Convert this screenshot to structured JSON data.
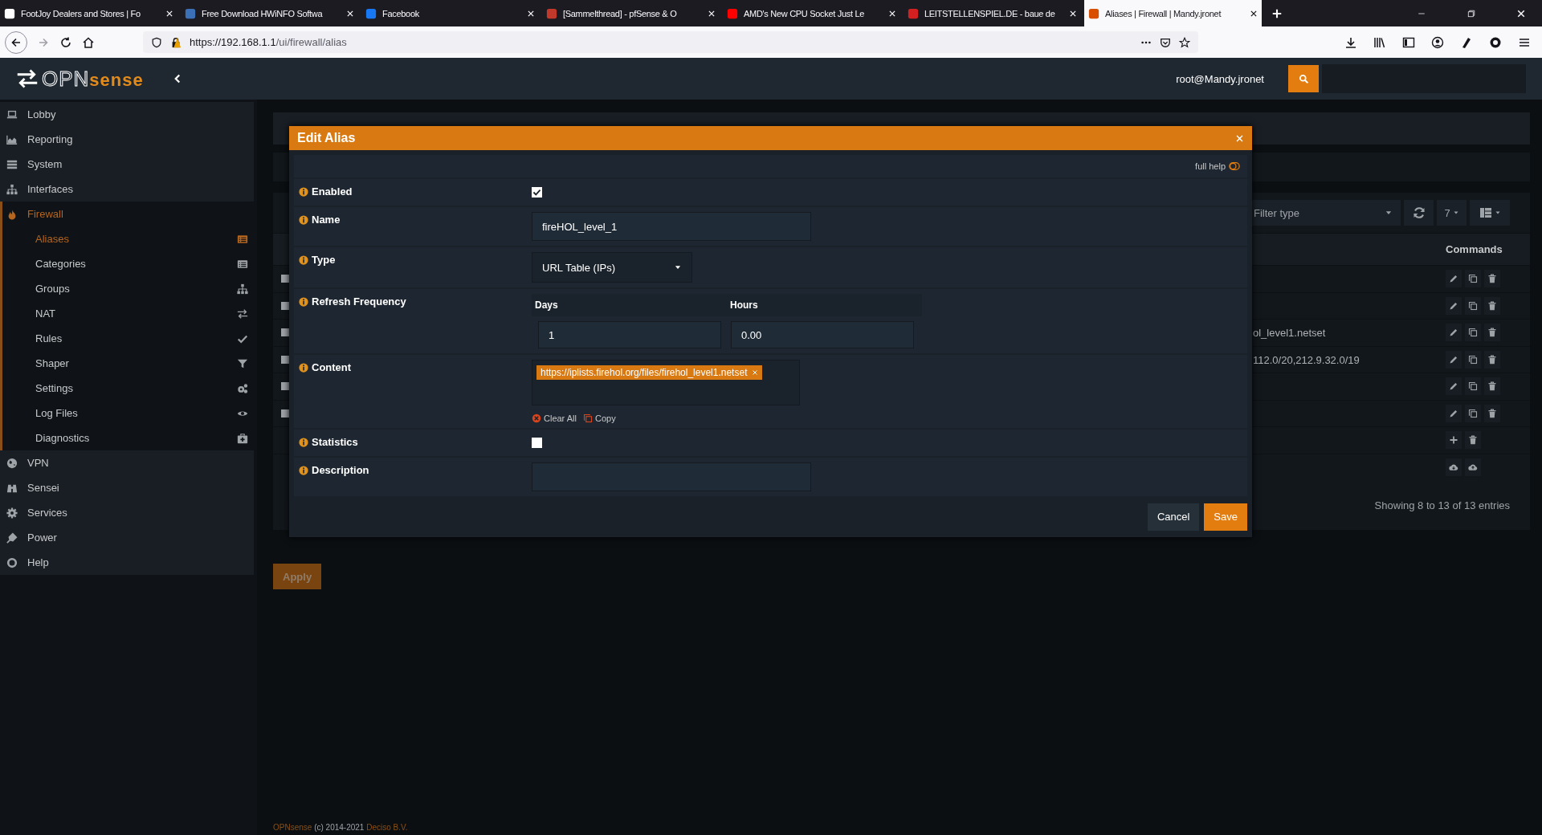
{
  "browser": {
    "tabs": [
      {
        "title": "FootJoy Dealers and Stores | Fo",
        "selected": false,
        "color": "#ffffff"
      },
      {
        "title": "Free Download HWiNFO Softwa",
        "selected": false,
        "color": "#3b6fb6"
      },
      {
        "title": "Facebook",
        "selected": false,
        "color": "#1877f2"
      },
      {
        "title": "[Sammelthread] - pfSense & O",
        "selected": false,
        "color": "#c0392b"
      },
      {
        "title": "AMD's New CPU Socket Just Le",
        "selected": false,
        "color": "#ff0000"
      },
      {
        "title": "LEITSTELLENSPIEL.DE - baue de",
        "selected": false,
        "color": "#d42020"
      },
      {
        "title": "Aliases | Firewall | Mandy.jronet",
        "selected": true,
        "color": "#d94f00"
      }
    ],
    "url": {
      "host": "https://192.168.1.1",
      "path": "/ui/firewall/alias"
    }
  },
  "header": {
    "logo": {
      "mark": "OPN",
      "word": "sense"
    },
    "user": "root@Mandy.jronet"
  },
  "sidebar": {
    "items": [
      {
        "label": "Lobby",
        "selected": false
      },
      {
        "label": "Reporting",
        "selected": false
      },
      {
        "label": "System",
        "selected": false
      },
      {
        "label": "Interfaces",
        "selected": false
      },
      {
        "label": "Firewall",
        "selected": true,
        "expanded": true,
        "children": [
          {
            "label": "Aliases",
            "selected": true
          },
          {
            "label": "Categories",
            "selected": false
          },
          {
            "label": "Groups",
            "selected": false
          },
          {
            "label": "NAT",
            "selected": false
          },
          {
            "label": "Rules",
            "selected": false
          },
          {
            "label": "Shaper",
            "selected": false
          },
          {
            "label": "Settings",
            "selected": false
          },
          {
            "label": "Log Files",
            "selected": false
          },
          {
            "label": "Diagnostics",
            "selected": false
          }
        ]
      },
      {
        "label": "VPN",
        "selected": false
      },
      {
        "label": "Sensei",
        "selected": false
      },
      {
        "label": "Services",
        "selected": false
      },
      {
        "label": "Power",
        "selected": false
      },
      {
        "label": "Help",
        "selected": false
      }
    ]
  },
  "table": {
    "filter": {
      "placeholder": "Filter type"
    },
    "page_size": "7",
    "columns": {
      "commands": "Commands"
    },
    "rows": [
      {
        "kind": "alias",
        "checked": false
      },
      {
        "kind": "alias",
        "checked": false
      },
      {
        "kind": "alias",
        "checked": false,
        "value": "ol_level1.netset"
      },
      {
        "kind": "alias",
        "checked": false,
        "value": "112.0/20,212.9.32.0/19"
      },
      {
        "kind": "alias",
        "checked": false
      },
      {
        "kind": "alias",
        "checked": false
      },
      {
        "kind": "add"
      },
      {
        "kind": "transfer"
      }
    ],
    "info": "Showing 8 to 13 of 13 entries"
  },
  "apply": {
    "label": "Apply",
    "disabled": true
  },
  "footer": {
    "brand": "OPNsense",
    "text": "(c) 2014-2021",
    "company": "Deciso B.V."
  },
  "modal": {
    "title": "Edit Alias",
    "full_help": {
      "label": "full help",
      "on": false
    },
    "fields": [
      {
        "kind": "checkbox",
        "label": "Enabled",
        "checked": true
      },
      {
        "kind": "text",
        "label": "Name",
        "value": "fireHOL_level_1"
      },
      {
        "kind": "select",
        "label": "Type",
        "value": "URL Table (IPs)"
      },
      {
        "kind": "frequency",
        "label": "Refresh Frequency",
        "days_label": "Days",
        "hours_label": "Hours",
        "days": "1",
        "hours": "0.00"
      },
      {
        "kind": "tags",
        "label": "Content",
        "tags": [
          "https://iplists.firehol.org/files/firehol_level1.netset"
        ],
        "clear_all": "Clear All",
        "copy": "Copy"
      },
      {
        "kind": "checkbox",
        "label": "Statistics",
        "checked": false
      },
      {
        "kind": "text",
        "label": "Description"
      }
    ],
    "buttons": {
      "cancel": "Cancel",
      "save": "Save"
    }
  }
}
